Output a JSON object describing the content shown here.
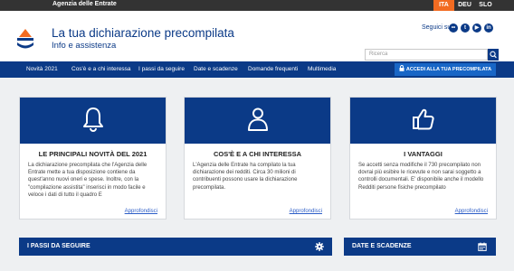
{
  "topbar": {
    "agency": "Agenzia delle Entrate",
    "languages": [
      "ITA",
      "DEU",
      "SLO"
    ]
  },
  "header": {
    "title": "La tua dichiarazione precompilata",
    "subtitle": "Info e assistenza",
    "follow_label": "Seguici su",
    "social_icons": [
      "flickr-icon",
      "twitter-icon",
      "youtube-icon",
      "linkedin-icon"
    ],
    "search_placeholder": "Ricerca"
  },
  "nav": {
    "items": [
      "Novità 2021",
      "Cos'è e a chi interessa",
      "I passi da seguire",
      "Date e scadenze",
      "Domande frequenti",
      "Multimedia"
    ],
    "cta": "ACCEDI ALLA TUA PRECOMPILATA"
  },
  "cards": [
    {
      "icon": "bell-icon",
      "title": "LE PRINCIPALI NOVITÀ DEL 2021",
      "text": "La dichiarazione precompilata che l'Agenzia delle Entrate mette a tua disposizione contiene da quest'anno nuovi oneri e spese. Inoltre, con la \"compilazione assistita\" inserisci in modo facile e veloce i dati di tutto il quadro E",
      "link": "Approfondisci"
    },
    {
      "icon": "person-icon",
      "title": "COS'È E A CHI INTERESSA",
      "text": "L'Agenzia delle Entrate ha compilato la tua dichiarazione dei redditi. Circa 30 milioni di contribuenti possono usare la dichiarazione precompilata.",
      "link": "Approfondisci"
    },
    {
      "icon": "thumbs-up-icon",
      "title": "I VANTAGGI",
      "text": "Se accetti senza modifiche il 730 precompilato non dovrai più esibire le ricevute e non sarai soggetto a controlli documentali. E' disponibile anche il modello Redditi persone fisiche precompilato",
      "link": "Approfondisci"
    }
  ],
  "bottom_bars": [
    {
      "label": "I PASSI DA SEGUIRE",
      "icon": "gear-icon"
    },
    {
      "label": "DATE E SCADENZE",
      "icon": "calendar-icon"
    }
  ],
  "colors": {
    "primary": "#0b3a87",
    "accent": "#f26b21",
    "cta": "#1866c6",
    "topbar": "#333333"
  }
}
